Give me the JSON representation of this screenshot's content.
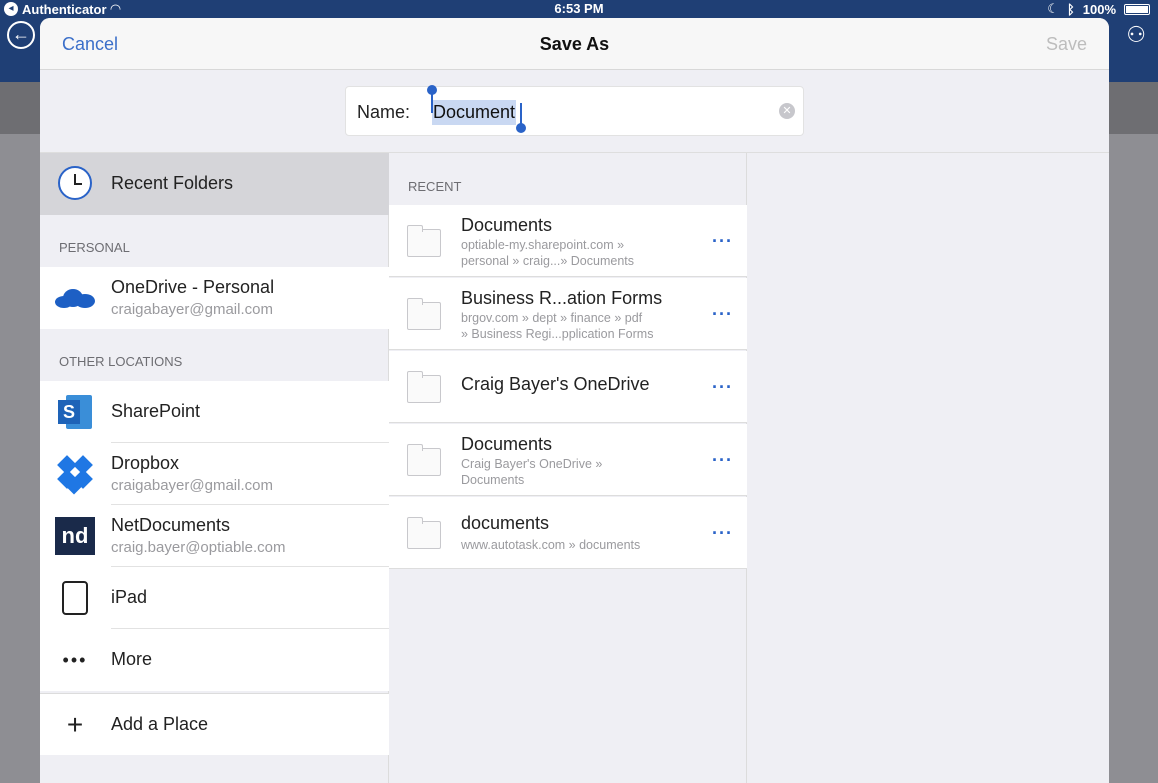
{
  "status_bar": {
    "back_app": "Authenticator",
    "time": "6:53 PM",
    "battery": "100%"
  },
  "dialog": {
    "cancel_label": "Cancel",
    "title": "Save As",
    "save_label": "Save"
  },
  "name_field": {
    "label": "Name:",
    "value": "Document"
  },
  "left_panel": {
    "recent_label": "Recent Folders",
    "personal_header": "PERSONAL",
    "personal_items": [
      {
        "name": "OneDrive - Personal",
        "sub": "craigabayer@gmail.com",
        "icon": "onedrive-icon"
      }
    ],
    "other_header": "OTHER LOCATIONS",
    "other_items": [
      {
        "name": "SharePoint",
        "sub": "",
        "icon": "sharepoint-icon"
      },
      {
        "name": "Dropbox",
        "sub": "craigabayer@gmail.com",
        "icon": "dropbox-icon"
      },
      {
        "name": "NetDocuments",
        "sub": "craig.bayer@optiable.com",
        "icon": "netdocuments-icon"
      },
      {
        "name": "iPad",
        "sub": "",
        "icon": "ipad-icon"
      },
      {
        "name": "More",
        "sub": "",
        "icon": "more-icon"
      }
    ],
    "add_place_label": "Add a Place",
    "nd_logo_text": "nd",
    "sp_logo_text": "S"
  },
  "middle_panel": {
    "header": "RECENT",
    "folders": [
      {
        "name": "Documents",
        "path1": "optiable-my.sharepoint.com »",
        "path2": "personal » craig...» Documents"
      },
      {
        "name": "Business R...ation Forms",
        "path1": "brgov.com » dept » finance » pdf",
        "path2": "» Business Regi...pplication Forms"
      },
      {
        "name": "Craig Bayer's OneDrive",
        "path1": "",
        "path2": ""
      },
      {
        "name": "Documents",
        "path1": "Craig Bayer's OneDrive »",
        "path2": "Documents"
      },
      {
        "name": "documents",
        "path1": "www.autotask.com » documents",
        "path2": ""
      }
    ]
  },
  "colors": {
    "accent": "#2a63c8",
    "nav_bg": "#1f3f75",
    "selected_row": "#d5d5d9"
  }
}
